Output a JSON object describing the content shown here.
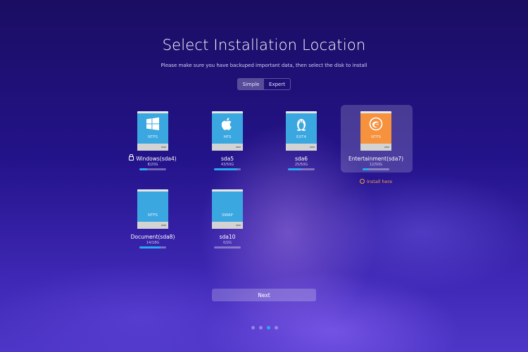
{
  "page": {
    "title": "Select Installation Location",
    "subtitle": "Please make sure you have backuped important data, then select the disk to install"
  },
  "mode_tabs": [
    {
      "label": "Simple",
      "active": true
    },
    {
      "label": "Expert",
      "active": false
    }
  ],
  "disks": [
    {
      "name": "Windows(sda4)",
      "size": "8/20G",
      "fs": "NTFS",
      "usage": 0.3,
      "locked": true,
      "color": "#3aa7e0",
      "icon": "windows-logo-icon"
    },
    {
      "name": "sda5",
      "size": "43/50G",
      "fs": "HFS",
      "usage": 0.86,
      "locked": false,
      "color": "#3aa7e0",
      "icon": "apple-logo-icon"
    },
    {
      "name": "sda6",
      "size": "25/50G",
      "fs": "EXT4",
      "usage": 0.5,
      "locked": false,
      "color": "#3aa7e0",
      "icon": "linux-penguin-icon"
    },
    {
      "name": "Entertainment(sda7)",
      "size": "12/50G",
      "fs": "NTFS",
      "usage": 0.24,
      "locked": false,
      "selected": true,
      "color": "#f6913d",
      "icon": "deepin-logo-icon",
      "install_label": "Install here"
    },
    {
      "name": "Document(sda8)",
      "size": "14/18G",
      "fs": "NTFS",
      "usage": 0.78,
      "locked": false,
      "color": "#3aa7e0",
      "icon": "none"
    },
    {
      "name": "sda10",
      "size": "0/2G",
      "fs": "SWAP",
      "usage": 0.0,
      "locked": false,
      "color": "#3aa7e0",
      "icon": "none"
    }
  ],
  "next_button": {
    "label": "Next"
  },
  "pagination": {
    "total": 4,
    "current": 3
  },
  "colors": {
    "accent": "#2aa9f2",
    "install_here": "#f59c4a"
  }
}
